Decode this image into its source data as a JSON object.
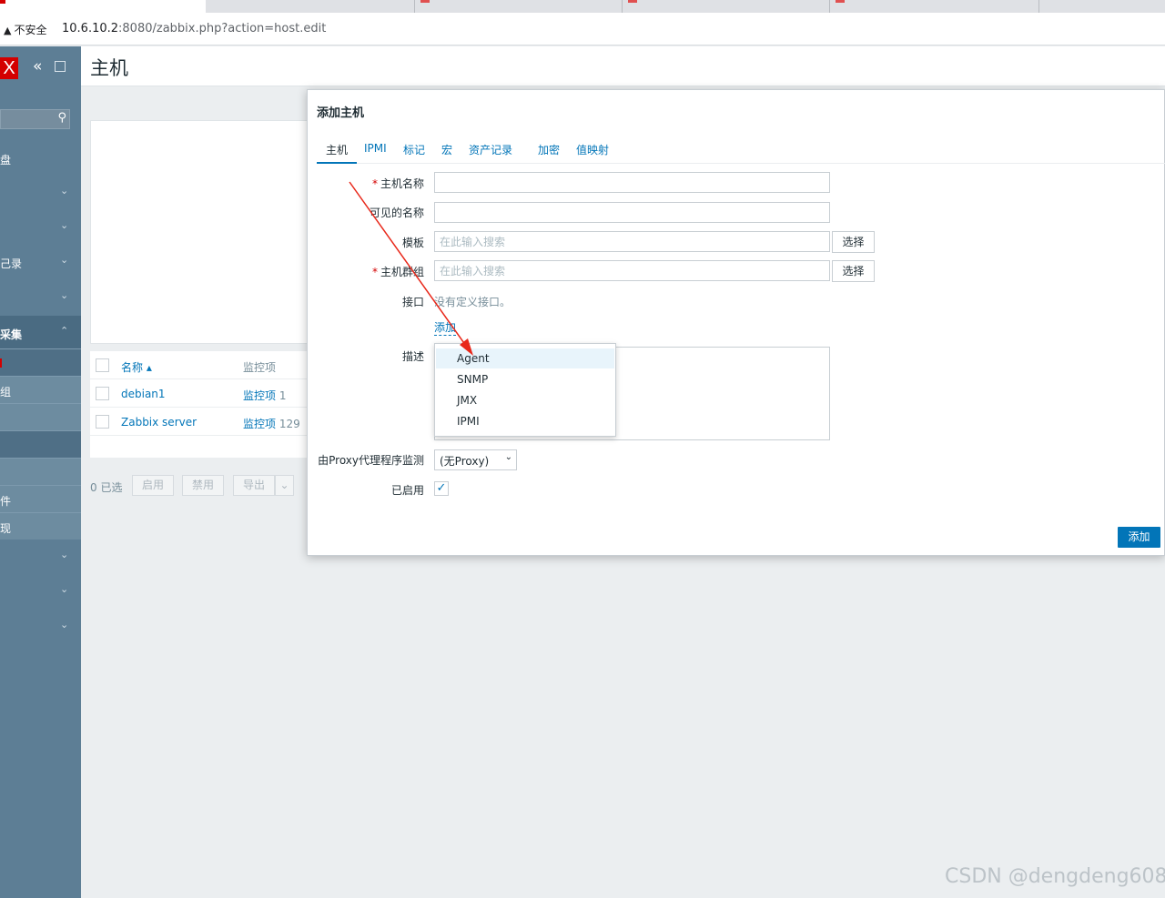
{
  "browser": {
    "security_label": "不安全",
    "url_host": "10.6.10.2",
    "url_rest": ":8080/zabbix.php?action=host.edit"
  },
  "sidebar": {
    "logo_text": "X",
    "items": [
      {
        "label": "盘",
        "chevron": ""
      },
      {
        "label": "",
        "chevron": "⌄"
      },
      {
        "label": "",
        "chevron": "⌄"
      },
      {
        "label": "己录",
        "chevron": "⌄"
      },
      {
        "label": "",
        "chevron": "⌄"
      },
      {
        "label": "采集",
        "chevron": "⌃"
      }
    ],
    "subitems": [
      "",
      "组",
      "",
      "",
      "",
      "件",
      "现"
    ],
    "bottom_chevrons": [
      "⌄",
      "⌄",
      "⌄"
    ]
  },
  "page": {
    "title": "主机"
  },
  "table": {
    "headers": {
      "name": "名称 ▴",
      "items": "监控项"
    },
    "rows": [
      {
        "name": "debian1",
        "items_label": "监控项",
        "items_count": "1"
      },
      {
        "name": "Zabbix server",
        "items_label": "监控项",
        "items_count": "129"
      }
    ],
    "selected": "0 已选",
    "buttons": {
      "enable": "启用",
      "disable": "禁用",
      "export": "导出"
    }
  },
  "dialog": {
    "title": "添加主机",
    "tabs": [
      "主机",
      "IPMI",
      "标记",
      "宏",
      "资产记录",
      "加密",
      "值映射"
    ],
    "fields": {
      "host_name": {
        "label": "主机名称",
        "value": "",
        "required": "*"
      },
      "visible_name": {
        "label": "可见的名称",
        "value": ""
      },
      "templates": {
        "label": "模板",
        "placeholder": "在此输入搜索",
        "button": "选择"
      },
      "host_groups": {
        "label": "主机群组",
        "placeholder": "在此输入搜索",
        "button": "选择",
        "required": "*"
      },
      "interfaces": {
        "label": "接口",
        "text": "没有定义接口。",
        "add_link": "添加"
      },
      "description": {
        "label": "描述"
      },
      "proxy": {
        "label": "由Proxy代理程序监测",
        "value": "(无Proxy)"
      },
      "enabled": {
        "label": "已启用",
        "checked": true
      }
    },
    "submit": "添加"
  },
  "dropdown": {
    "options": [
      "Agent",
      "SNMP",
      "JMX",
      "IPMI"
    ],
    "highlighted": "Agent"
  },
  "watermark": "CSDN @dengdeng608",
  "colors": {
    "sidebar": "#5d7e95",
    "accent": "#0275b8",
    "brand": "#d40000",
    "arrow": "#e8281a"
  }
}
